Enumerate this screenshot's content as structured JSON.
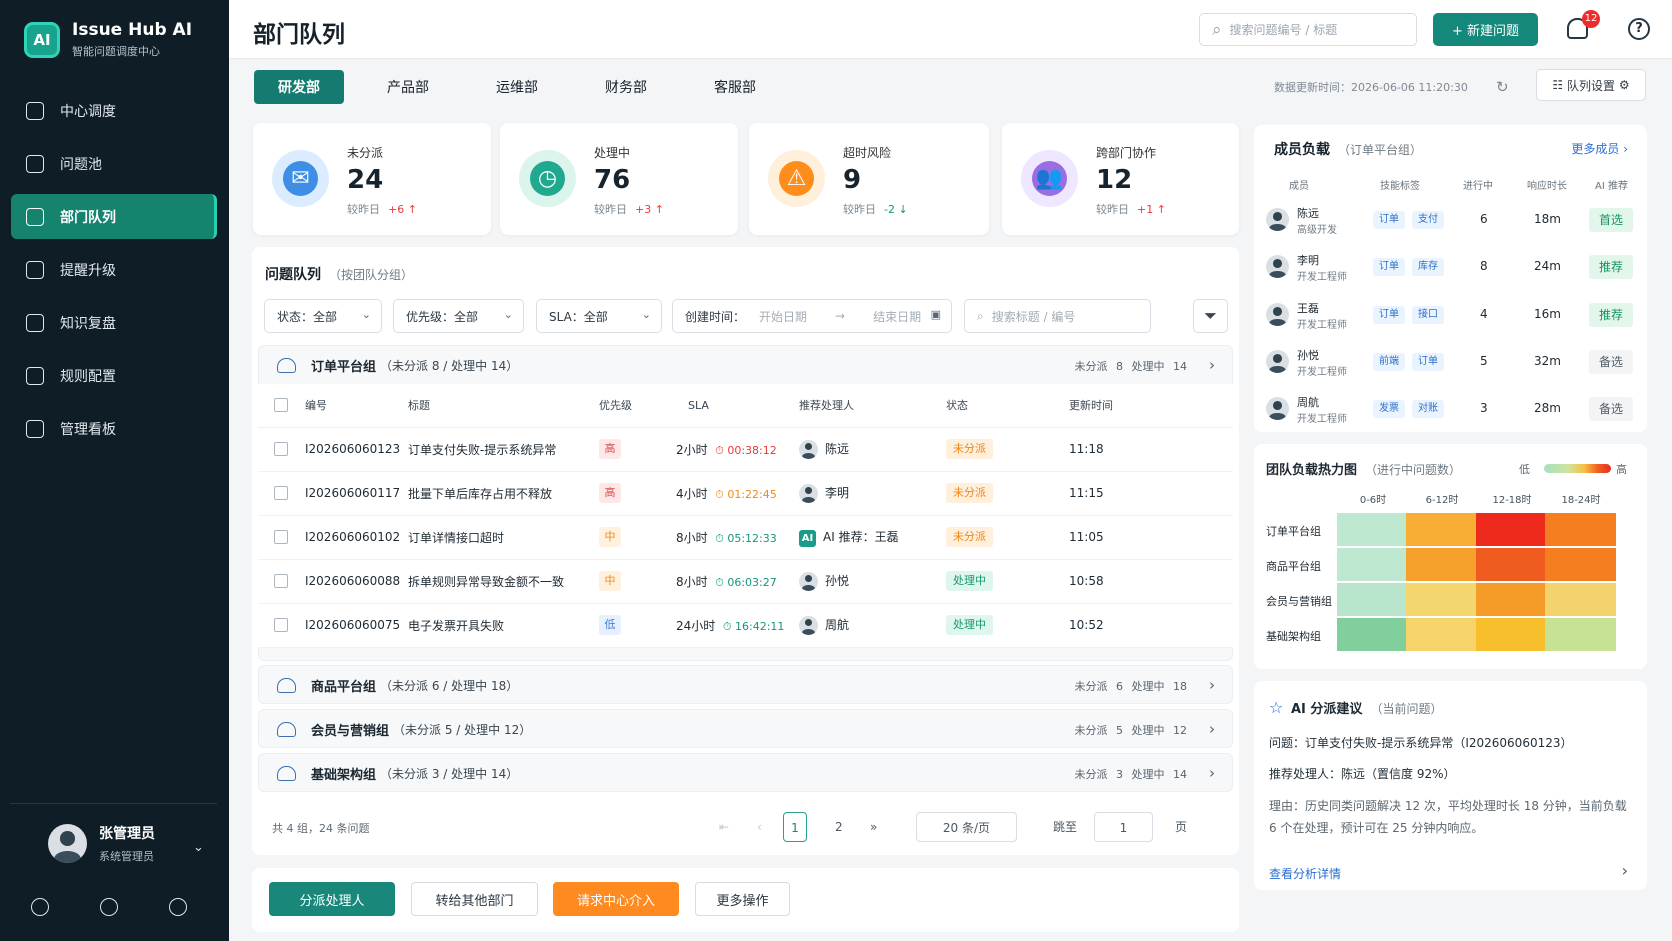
{
  "app": {
    "title": "Issue Hub AI",
    "subtitle": "智能问题调度中心",
    "logo_text": "AI"
  },
  "nav": [
    "中心调度",
    "问题池",
    "部门队列",
    "提醒升级",
    "知识复盘",
    "规则配置",
    "管理看板"
  ],
  "user": {
    "name": "张管理员",
    "role": "系统管理员"
  },
  "header": {
    "title": "部门队列",
    "search_placeholder": "搜索问题编号 / 标题",
    "new_button": "+ 新建问题",
    "notification_count": "12",
    "help": "?"
  },
  "tabs": [
    "研发部",
    "产品部",
    "运维部",
    "财务部",
    "客服部"
  ],
  "status_bar": {
    "updated": "数据更新时间：2026-06-06 11:20:30",
    "queue_settings": "队列设置"
  },
  "stats": [
    {
      "label": "未分派",
      "value": "24",
      "compare": "较昨日",
      "delta": "+6 ↑",
      "icon": "mail-icon",
      "color": "#3e8ee5"
    },
    {
      "label": "处理中",
      "value": "76",
      "compare": "较昨日",
      "delta": "+3 ↑",
      "icon": "clock-icon",
      "color": "#20a98e"
    },
    {
      "label": "超时风险",
      "value": "9",
      "compare": "较昨日",
      "delta": "-2 ↓",
      "icon": "warning-icon",
      "color": "#ff8d1c"
    },
    {
      "label": "跨部门协作",
      "value": "12",
      "compare": "较昨日",
      "delta": "+1 ↑",
      "icon": "users-icon",
      "color": "#9a6ee3"
    }
  ],
  "queue": {
    "title": "问题队列",
    "note": "（按团队分组）"
  },
  "filters": [
    {
      "label": "状态：全部"
    },
    {
      "label": "优先级：全部"
    },
    {
      "label": "SLA：全部"
    },
    {
      "label": "创建时间：",
      "start": "开始日期",
      "arrow": "→",
      "end": "结束日期"
    },
    {
      "label": "搜索标题 / 编号"
    }
  ],
  "groups": [
    {
      "name": "订单平台组",
      "summary": "（未分派 8 / 处理中 14）",
      "counts": "未分派  8     处理中  14"
    },
    {
      "name": "商品平台组",
      "summary": "（未分派 6 / 处理中 18）",
      "counts": "未分派  6     处理中  18"
    },
    {
      "name": "会员与营销组",
      "summary": "（未分派 5 / 处理中 12）",
      "counts": "未分派  5     处理中  12"
    },
    {
      "name": "基础架构组",
      "summary": "（未分派 3 / 处理中 14）",
      "counts": "未分派  3     处理中  14"
    }
  ],
  "table": {
    "headers": [
      "编号",
      "标题",
      "优先级",
      "SLA",
      "推荐处理人",
      "状态",
      "更新时间"
    ],
    "rows": [
      {
        "id": "I202606060123",
        "title": "订单支付失败-提示系统异常",
        "priority": "高",
        "sla": "2小时",
        "timer": "⏱ 00:38:12",
        "owner": "陈远",
        "status": "未分派",
        "time": "11:18"
      },
      {
        "id": "I202606060117",
        "title": "批量下单后库存占用不释放",
        "priority": "高",
        "sla": "4小时",
        "timer": "⏱ 01:22:45",
        "owner": "李明",
        "status": "未分派",
        "time": "11:15"
      },
      {
        "id": "I202606060102",
        "title": "订单详情接口超时",
        "priority": "中",
        "sla": "8小时",
        "timer": "⏱ 05:12:33",
        "owner": "AI 推荐：王磊",
        "status": "未分派",
        "time": "11:05"
      },
      {
        "id": "I202606060088",
        "title": "拆单规则异常导致金额不一致",
        "priority": "中",
        "sla": "8小时",
        "timer": "⏱ 06:03:27",
        "owner": "孙悦",
        "status": "处理中",
        "time": "10:58"
      },
      {
        "id": "I202606060075",
        "title": "电子发票开具失败",
        "priority": "低",
        "sla": "24小时",
        "timer": "⏱ 16:42:11",
        "owner": "周航",
        "status": "处理中",
        "time": "10:52"
      }
    ]
  },
  "pagination": {
    "total": "共 4 组，24 条问题",
    "first": "⇤",
    "prev": "‹",
    "page1": "1",
    "page2": "2",
    "next": "»",
    "size": "20 条/页",
    "jump": "跳至",
    "page_input": "1",
    "page_unit": "页"
  },
  "actions": [
    "分派处理人",
    "转给其他部门",
    "请求中心介入",
    "更多操作"
  ],
  "members": {
    "title": "成员负载",
    "note": "（订单平台组）",
    "more": "更多成员 ›",
    "headers": [
      "成员",
      "技能标签",
      "进行中",
      "响应时长",
      "AI 推荐"
    ],
    "rows": [
      {
        "name": "陈远",
        "role": "高级开发",
        "skills": [
          "订单",
          "支付"
        ],
        "active": "6",
        "response": "18m",
        "recommend": "首选"
      },
      {
        "name": "李明",
        "role": "开发工程师",
        "skills": [
          "订单",
          "库存"
        ],
        "active": "8",
        "response": "24m",
        "recommend": "推荐"
      },
      {
        "name": "王磊",
        "role": "开发工程师",
        "skills": [
          "订单",
          "接口"
        ],
        "active": "4",
        "response": "16m",
        "recommend": "推荐"
      },
      {
        "name": "孙悦",
        "role": "开发工程师",
        "skills": [
          "前端",
          "订单"
        ],
        "active": "5",
        "response": "32m",
        "recommend": "备选"
      },
      {
        "name": "周航",
        "role": "开发工程师",
        "skills": [
          "发票",
          "对账"
        ],
        "active": "3",
        "response": "28m",
        "recommend": "备选"
      }
    ]
  },
  "heatmap": {
    "title": "团队负载热力图",
    "note": "（进行中问题数）",
    "low": "低",
    "high": "高",
    "columns": [
      "0-6时",
      "6-12时",
      "12-18时",
      "18-24时"
    ],
    "rows": [
      "订单平台组",
      "商品平台组",
      "会员与营销组",
      "基础架构组"
    ],
    "colors": [
      [
        "#bfe8d1",
        "#f8ad35",
        "#ee2a1c",
        "#f57f20"
      ],
      [
        "#bfe8d1",
        "#f6a12c",
        "#f05b1f",
        "#f47d20"
      ],
      [
        "#b8e5cc",
        "#f4d66f",
        "#f49b28",
        "#f4d36f"
      ],
      [
        "#82cf9e",
        "#f6d46b",
        "#f8bf2d",
        "#c8e293"
      ]
    ]
  },
  "ai": {
    "title": "AI 分派建议",
    "note": "（当前问题）",
    "issue": "问题：订单支付失败-提示系统异常（I202606060123）",
    "recommend": "推荐处理人：陈远（置信度 92%）",
    "reason1": "理由：历史同类问题解决 12 次，平均处理时长 18 分钟，当前负载",
    "reason2": "6 个在处理，预计可在 25 分钟内响应。",
    "link": "查看分析详情"
  },
  "colors": {
    "accent": "#14887a",
    "danger": "#e33c3c",
    "warning": "#ff8a1f",
    "info": "#2f6fd0"
  }
}
